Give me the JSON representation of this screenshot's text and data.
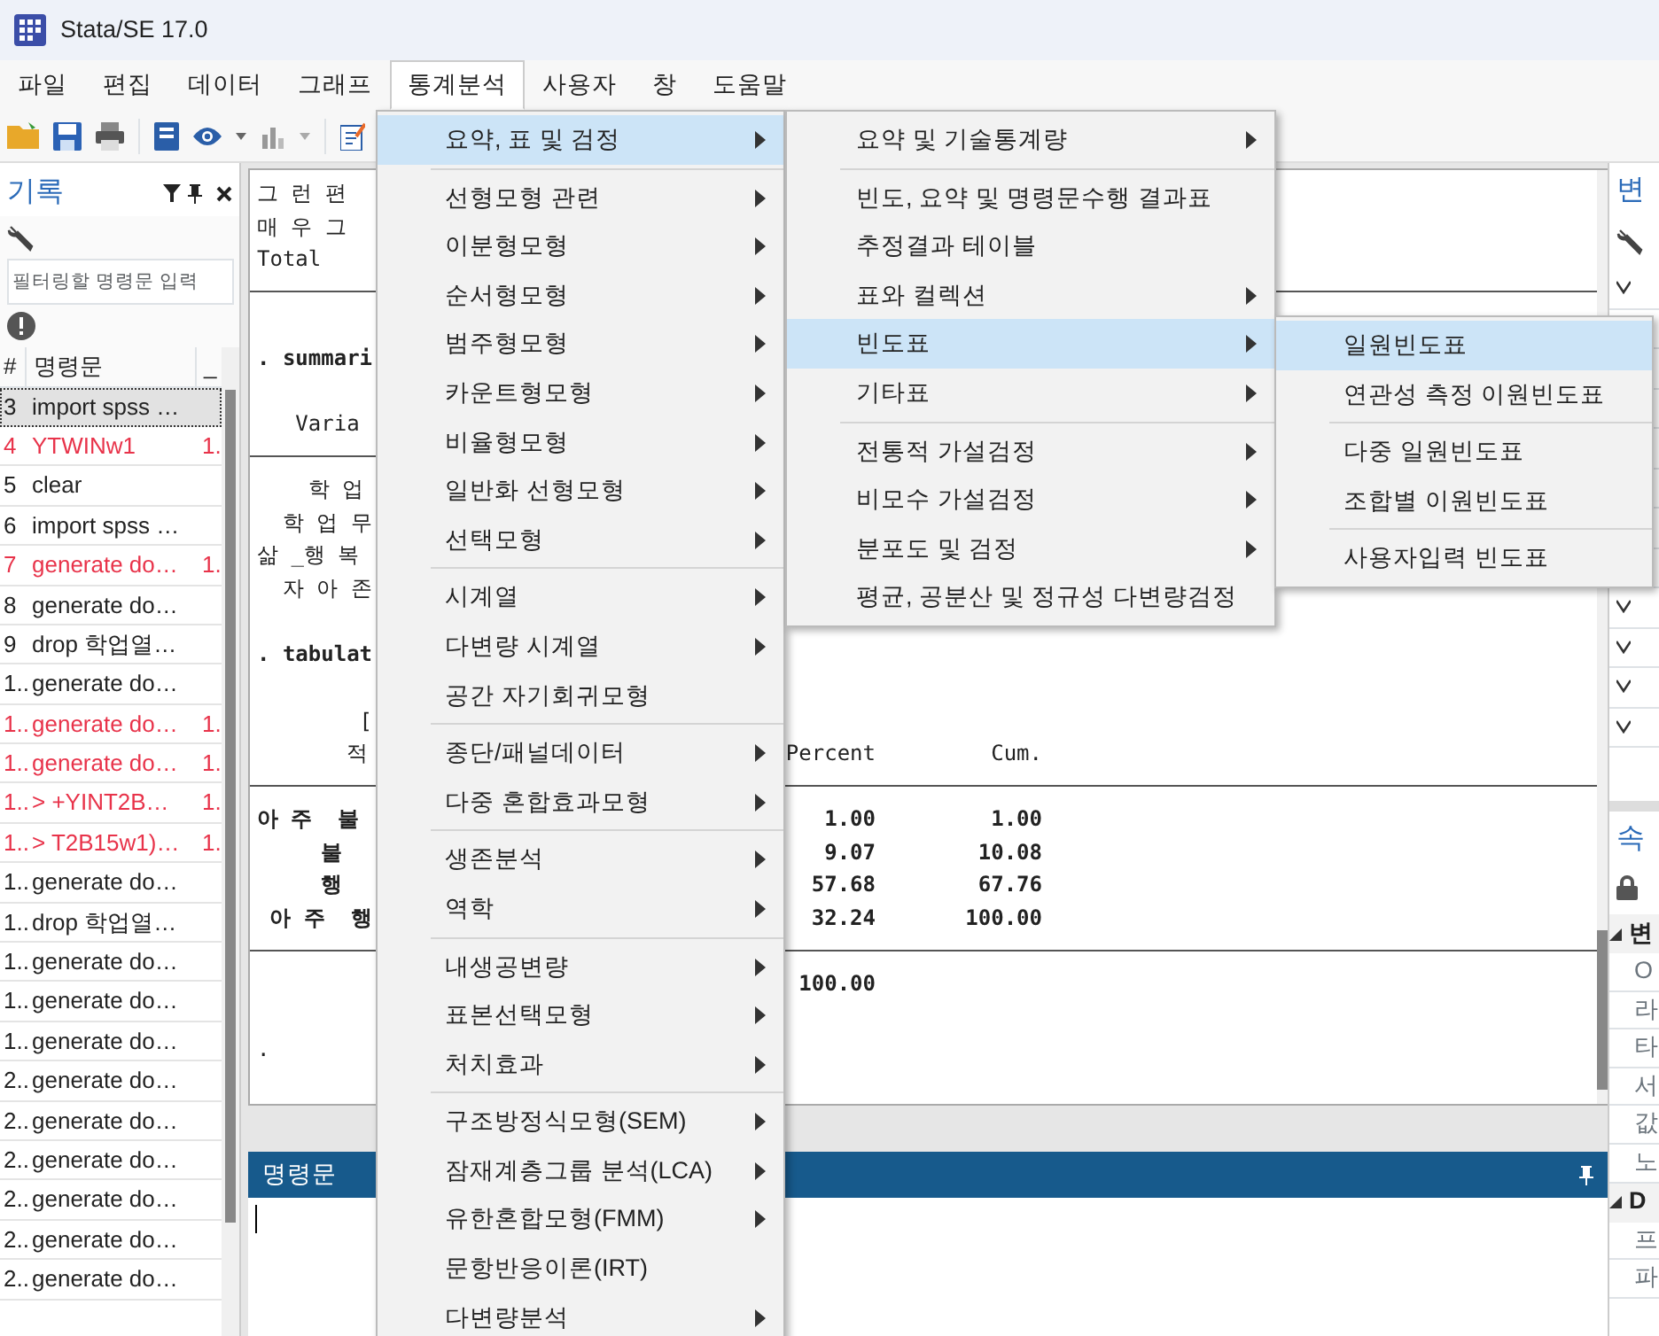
{
  "window": {
    "title": "Stata/SE 17.0"
  },
  "menubar": [
    {
      "label": "파일",
      "selected": false
    },
    {
      "label": "편집",
      "selected": false
    },
    {
      "label": "데이터",
      "selected": false
    },
    {
      "label": "그래프",
      "selected": false
    },
    {
      "label": "통계분석",
      "selected": true
    },
    {
      "label": "사용자",
      "selected": false
    },
    {
      "label": "창",
      "selected": false
    },
    {
      "label": "도움말",
      "selected": false
    }
  ],
  "history": {
    "title": "기록",
    "filter_placeholder": "필터링할 명령문 입력",
    "columns": [
      "#",
      "명령문",
      "_"
    ],
    "rows": [
      {
        "num": "3",
        "command": "import spss …",
        "error": false,
        "selected": true
      },
      {
        "num": "4",
        "command": "YTWINw1",
        "rc": "1.",
        "error": true,
        "selected": false
      },
      {
        "num": "5",
        "command": "clear",
        "error": false,
        "selected": false
      },
      {
        "num": "6",
        "command": "import spss …",
        "error": false,
        "selected": false
      },
      {
        "num": "7",
        "command": "generate do…",
        "rc": "1.",
        "error": true,
        "selected": false
      },
      {
        "num": "8",
        "command": "generate do…",
        "error": false,
        "selected": false
      },
      {
        "num": "9",
        "command": "drop 학업열…",
        "error": false,
        "selected": false
      },
      {
        "num": "1..",
        "command": "generate do…",
        "error": false,
        "selected": false
      },
      {
        "num": "1..",
        "command": "generate do…",
        "rc": "1.",
        "error": true,
        "selected": false
      },
      {
        "num": "1..",
        "command": "generate do…",
        "rc": "1.",
        "error": true,
        "selected": false
      },
      {
        "num": "1..",
        "command": ">   +YINT2B…",
        "rc": "1.",
        "error": true,
        "selected": false
      },
      {
        "num": "1..",
        "command": "> T2B15w1)…",
        "rc": "1.",
        "error": true,
        "selected": false
      },
      {
        "num": "1..",
        "command": "generate do…",
        "error": false,
        "selected": false
      },
      {
        "num": "1..",
        "command": "drop 학업열…",
        "error": false,
        "selected": false
      },
      {
        "num": "1..",
        "command": "generate do…",
        "error": false,
        "selected": false
      },
      {
        "num": "1..",
        "command": "generate do…",
        "error": false,
        "selected": false
      },
      {
        "num": "1..",
        "command": "generate do…",
        "error": false,
        "selected": false
      },
      {
        "num": "2..",
        "command": "generate do…",
        "error": false,
        "selected": false
      },
      {
        "num": "2..",
        "command": "generate do…",
        "error": false,
        "selected": false
      },
      {
        "num": "2..",
        "command": "generate do…",
        "error": false,
        "selected": false
      },
      {
        "num": "2..",
        "command": "generate do…",
        "error": false,
        "selected": false
      },
      {
        "num": "2..",
        "command": "generate do…",
        "error": false,
        "selected": false
      },
      {
        "num": "2..",
        "command": "generate do…",
        "error": false,
        "selected": false
      }
    ]
  },
  "results": {
    "lines": [
      {
        "kind": "text",
        "text": "그 런 편"
      },
      {
        "kind": "text",
        "text": "매 우 그"
      },
      {
        "kind": "text",
        "text": "Total"
      },
      {
        "kind": "rule"
      },
      {
        "kind": "blank"
      },
      {
        "kind": "command",
        "text": ". summari"
      },
      {
        "kind": "blank"
      },
      {
        "kind": "text",
        "text": "   Varia"
      },
      {
        "kind": "rule"
      },
      {
        "kind": "text",
        "text": "    학 업"
      },
      {
        "kind": "text",
        "text": "  학 업 무"
      },
      {
        "kind": "text",
        "text": "삶 _행 복"
      },
      {
        "kind": "text",
        "text": "  자 아 존"
      },
      {
        "kind": "blank"
      },
      {
        "kind": "command",
        "text": ". tabulat"
      },
      {
        "kind": "blank"
      },
      {
        "kind": "text",
        "text": "        ["
      },
      {
        "kind": "row",
        "text": "       적",
        "percent": "Percent",
        "cum": "Cum.",
        "bold": false
      },
      {
        "kind": "rule"
      },
      {
        "kind": "row",
        "text": "아 주  불",
        "percent": "1.00",
        "cum": "1.00",
        "bold": true
      },
      {
        "kind": "row",
        "text": "     불",
        "percent": "9.07",
        "cum": "10.08",
        "bold": true
      },
      {
        "kind": "row",
        "text": "     행",
        "percent": "57.68",
        "cum": "67.76",
        "bold": true
      },
      {
        "kind": "row",
        "text": " 아 주  행",
        "percent": "32.24",
        "cum": "100.00",
        "bold": true
      },
      {
        "kind": "rule"
      },
      {
        "kind": "row",
        "percent": "100.00",
        "bold": true
      },
      {
        "kind": "blank"
      },
      {
        "kind": "text",
        "text": "."
      }
    ]
  },
  "command_window": {
    "title": "명령문"
  },
  "variables_panel": {
    "title": "변"
  },
  "properties_panel": {
    "title": "속",
    "sections": [
      {
        "label": "변",
        "items": [
          "O",
          "라",
          "타",
          "서",
          "값",
          "노"
        ]
      },
      {
        "label": "D",
        "items": [
          "프",
          "파"
        ]
      }
    ]
  },
  "menus": [
    {
      "items": [
        {
          "kind": "item",
          "label": "요약, 표 및 검정",
          "submenu": true,
          "selected": true
        },
        {
          "kind": "separator"
        },
        {
          "kind": "item",
          "label": "선형모형 관련",
          "submenu": true,
          "selected": false
        },
        {
          "kind": "item",
          "label": "이분형모형",
          "submenu": true,
          "selected": false
        },
        {
          "kind": "item",
          "label": "순서형모형",
          "submenu": true,
          "selected": false
        },
        {
          "kind": "item",
          "label": "범주형모형",
          "submenu": true,
          "selected": false
        },
        {
          "kind": "item",
          "label": "카운트형모형",
          "submenu": true,
          "selected": false
        },
        {
          "kind": "item",
          "label": "비율형모형",
          "submenu": true,
          "selected": false
        },
        {
          "kind": "item",
          "label": "일반화 선형모형",
          "submenu": true,
          "selected": false
        },
        {
          "kind": "item",
          "label": "선택모형",
          "submenu": true,
          "selected": false
        },
        {
          "kind": "separator"
        },
        {
          "kind": "item",
          "label": "시계열",
          "submenu": true,
          "selected": false
        },
        {
          "kind": "item",
          "label": "다변량 시계열",
          "submenu": true,
          "selected": false
        },
        {
          "kind": "item",
          "label": "공간 자기회귀모형",
          "submenu": false,
          "selected": false
        },
        {
          "kind": "separator"
        },
        {
          "kind": "item",
          "label": "종단/패널데이터",
          "submenu": true,
          "selected": false
        },
        {
          "kind": "item",
          "label": "다중 혼합효과모형",
          "submenu": true,
          "selected": false
        },
        {
          "kind": "separator"
        },
        {
          "kind": "item",
          "label": "생존분석",
          "submenu": true,
          "selected": false
        },
        {
          "kind": "item",
          "label": "역학",
          "submenu": true,
          "selected": false
        },
        {
          "kind": "separator"
        },
        {
          "kind": "item",
          "label": "내생공변량",
          "submenu": true,
          "selected": false
        },
        {
          "kind": "item",
          "label": "표본선택모형",
          "submenu": true,
          "selected": false
        },
        {
          "kind": "item",
          "label": "처치효과",
          "submenu": true,
          "selected": false
        },
        {
          "kind": "separator"
        },
        {
          "kind": "item",
          "label": "구조방정식모형(SEM)",
          "submenu": true,
          "selected": false
        },
        {
          "kind": "item",
          "label": "잠재계층그룹 분석(LCA)",
          "submenu": true,
          "selected": false
        },
        {
          "kind": "item",
          "label": "유한혼합모형(FMM)",
          "submenu": true,
          "selected": false
        },
        {
          "kind": "item",
          "label": "문항반응이론(IRT)",
          "submenu": false,
          "selected": false
        },
        {
          "kind": "item",
          "label": "다변량분석",
          "submenu": true,
          "selected": false
        }
      ]
    },
    {
      "items": [
        {
          "kind": "item",
          "label": "요약 및 기술통계량",
          "submenu": true,
          "selected": false
        },
        {
          "kind": "separator"
        },
        {
          "kind": "item",
          "label": "빈도, 요약 및 명령문수행 결과표",
          "submenu": false,
          "selected": false
        },
        {
          "kind": "item",
          "label": "추정결과 테이블",
          "submenu": false,
          "selected": false
        },
        {
          "kind": "item",
          "label": "표와 컬렉션",
          "submenu": true,
          "selected": false
        },
        {
          "kind": "item",
          "label": "빈도표",
          "submenu": true,
          "selected": true
        },
        {
          "kind": "item",
          "label": "기타표",
          "submenu": true,
          "selected": false
        },
        {
          "kind": "separator"
        },
        {
          "kind": "item",
          "label": "전통적 가설검정",
          "submenu": true,
          "selected": false
        },
        {
          "kind": "item",
          "label": "비모수 가설검정",
          "submenu": true,
          "selected": false
        },
        {
          "kind": "item",
          "label": "분포도 및 검정",
          "submenu": true,
          "selected": false
        },
        {
          "kind": "item",
          "label": "평균, 공분산 및 정규성 다변량검정",
          "submenu": false,
          "selected": false
        }
      ]
    },
    {
      "items": [
        {
          "kind": "item",
          "label": "일원빈도표",
          "submenu": false,
          "selected": true
        },
        {
          "kind": "item",
          "label": "연관성 측정 이원빈도표",
          "submenu": false,
          "selected": false
        },
        {
          "kind": "separator"
        },
        {
          "kind": "item",
          "label": "다중 일원빈도표",
          "submenu": false,
          "selected": false
        },
        {
          "kind": "item",
          "label": "조합별 이원빈도표",
          "submenu": false,
          "selected": false
        },
        {
          "kind": "separator"
        },
        {
          "kind": "item",
          "label": "사용자입력 빈도표",
          "submenu": false,
          "selected": false
        }
      ]
    }
  ]
}
